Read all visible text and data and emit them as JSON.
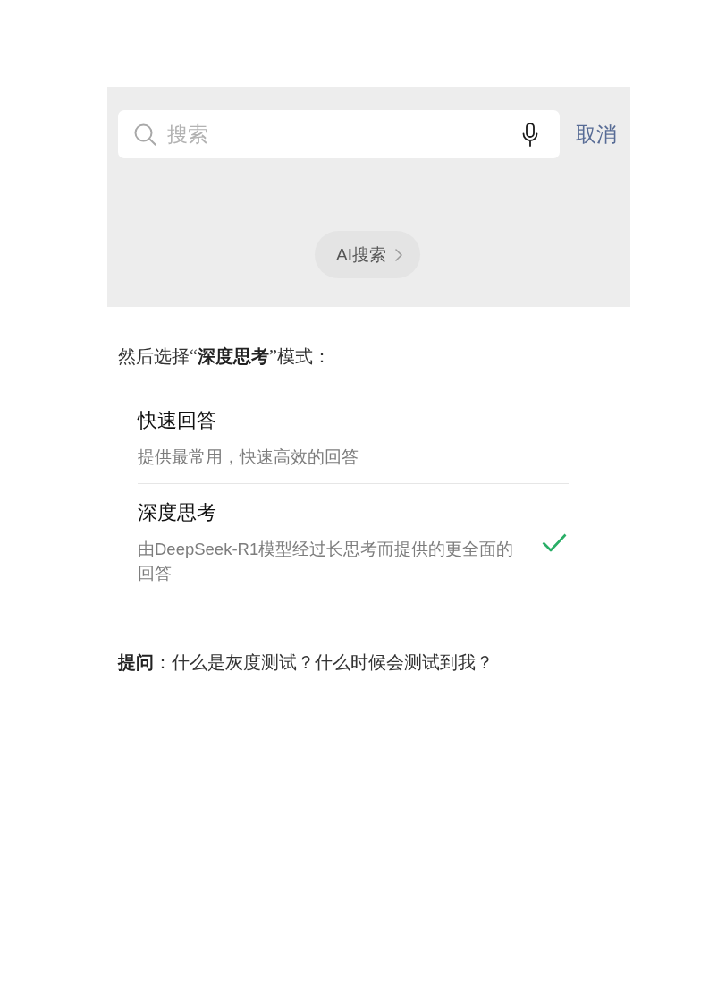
{
  "screenshot": {
    "search": {
      "placeholder": "搜索"
    },
    "cancel": "取消",
    "ai_search": "AI搜索"
  },
  "instruction": "然后选择“**深度思考**”模式：",
  "modes": [
    {
      "title": "快速回答",
      "description": "提供最常用，快速高效的回答",
      "selected": false
    },
    {
      "title": "深度思考",
      "description": "由DeepSeek-R1模型经过长思考而提供的更全面的回答",
      "selected": true
    }
  ],
  "question": "**提问**：什么是灰度测试？什么时候会测试到我？"
}
